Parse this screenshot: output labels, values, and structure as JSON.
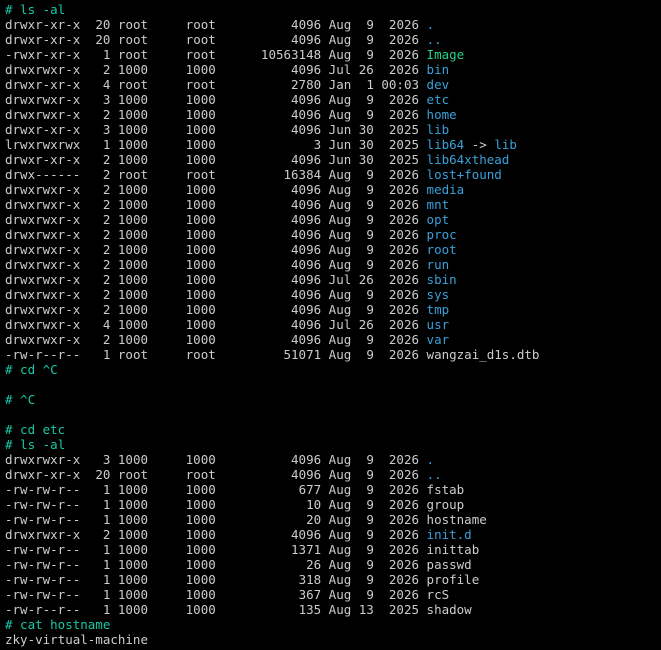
{
  "colors": {
    "background": "#000000",
    "text": "#cccccc",
    "prompt": "#17c9a6",
    "directory": "#3aa0d9",
    "executable": "#23d18b",
    "symlink": "#3aa0d9"
  },
  "lines": [
    {
      "kind": "prompt",
      "text": "# ls -al"
    },
    {
      "kind": "entry",
      "perms": "drwxr-xr-x",
      "links": "20",
      "owner": "root",
      "group": "root",
      "size": "4096",
      "month": "Aug",
      "day": "9",
      "yt": "2026",
      "name": ".",
      "type": "dir"
    },
    {
      "kind": "entry",
      "perms": "drwxr-xr-x",
      "links": "20",
      "owner": "root",
      "group": "root",
      "size": "4096",
      "month": "Aug",
      "day": "9",
      "yt": "2026",
      "name": "..",
      "type": "dir"
    },
    {
      "kind": "entry",
      "perms": "-rwxr-xr-x",
      "links": "1",
      "owner": "root",
      "group": "root",
      "size": "10563148",
      "month": "Aug",
      "day": "9",
      "yt": "2026",
      "name": "Image",
      "type": "exec"
    },
    {
      "kind": "entry",
      "perms": "drwxrwxr-x",
      "links": "2",
      "owner": "1000",
      "group": "1000",
      "size": "4096",
      "month": "Jul",
      "day": "26",
      "yt": "2026",
      "name": "bin",
      "type": "dir"
    },
    {
      "kind": "entry",
      "perms": "drwxr-xr-x",
      "links": "4",
      "owner": "root",
      "group": "root",
      "size": "2780",
      "month": "Jan",
      "day": "1",
      "yt": "00:03",
      "name": "dev",
      "type": "dir"
    },
    {
      "kind": "entry",
      "perms": "drwxrwxr-x",
      "links": "3",
      "owner": "1000",
      "group": "1000",
      "size": "4096",
      "month": "Aug",
      "day": "9",
      "yt": "2026",
      "name": "etc",
      "type": "dir"
    },
    {
      "kind": "entry",
      "perms": "drwxrwxr-x",
      "links": "2",
      "owner": "1000",
      "group": "1000",
      "size": "4096",
      "month": "Aug",
      "day": "9",
      "yt": "2026",
      "name": "home",
      "type": "dir"
    },
    {
      "kind": "entry",
      "perms": "drwxr-xr-x",
      "links": "3",
      "owner": "1000",
      "group": "1000",
      "size": "4096",
      "month": "Jun",
      "day": "30",
      "yt": "2025",
      "name": "lib",
      "type": "dir"
    },
    {
      "kind": "entry",
      "perms": "lrwxrwxrwx",
      "links": "1",
      "owner": "1000",
      "group": "1000",
      "size": "3",
      "month": "Jun",
      "day": "30",
      "yt": "2025",
      "name": "lib64",
      "type": "link",
      "target": "lib"
    },
    {
      "kind": "entry",
      "perms": "drwxr-xr-x",
      "links": "2",
      "owner": "1000",
      "group": "1000",
      "size": "4096",
      "month": "Jun",
      "day": "30",
      "yt": "2025",
      "name": "lib64xthead",
      "type": "dir"
    },
    {
      "kind": "entry",
      "perms": "drwx------",
      "links": "2",
      "owner": "root",
      "group": "root",
      "size": "16384",
      "month": "Aug",
      "day": "9",
      "yt": "2026",
      "name": "lost+found",
      "type": "dir"
    },
    {
      "kind": "entry",
      "perms": "drwxrwxr-x",
      "links": "2",
      "owner": "1000",
      "group": "1000",
      "size": "4096",
      "month": "Aug",
      "day": "9",
      "yt": "2026",
      "name": "media",
      "type": "dir"
    },
    {
      "kind": "entry",
      "perms": "drwxrwxr-x",
      "links": "2",
      "owner": "1000",
      "group": "1000",
      "size": "4096",
      "month": "Aug",
      "day": "9",
      "yt": "2026",
      "name": "mnt",
      "type": "dir"
    },
    {
      "kind": "entry",
      "perms": "drwxrwxr-x",
      "links": "2",
      "owner": "1000",
      "group": "1000",
      "size": "4096",
      "month": "Aug",
      "day": "9",
      "yt": "2026",
      "name": "opt",
      "type": "dir"
    },
    {
      "kind": "entry",
      "perms": "drwxrwxr-x",
      "links": "2",
      "owner": "1000",
      "group": "1000",
      "size": "4096",
      "month": "Aug",
      "day": "9",
      "yt": "2026",
      "name": "proc",
      "type": "dir"
    },
    {
      "kind": "entry",
      "perms": "drwxrwxr-x",
      "links": "2",
      "owner": "1000",
      "group": "1000",
      "size": "4096",
      "month": "Aug",
      "day": "9",
      "yt": "2026",
      "name": "root",
      "type": "dir"
    },
    {
      "kind": "entry",
      "perms": "drwxrwxr-x",
      "links": "2",
      "owner": "1000",
      "group": "1000",
      "size": "4096",
      "month": "Aug",
      "day": "9",
      "yt": "2026",
      "name": "run",
      "type": "dir"
    },
    {
      "kind": "entry",
      "perms": "drwxrwxr-x",
      "links": "2",
      "owner": "1000",
      "group": "1000",
      "size": "4096",
      "month": "Jul",
      "day": "26",
      "yt": "2026",
      "name": "sbin",
      "type": "dir"
    },
    {
      "kind": "entry",
      "perms": "drwxrwxr-x",
      "links": "2",
      "owner": "1000",
      "group": "1000",
      "size": "4096",
      "month": "Aug",
      "day": "9",
      "yt": "2026",
      "name": "sys",
      "type": "dir"
    },
    {
      "kind": "entry",
      "perms": "drwxrwxr-x",
      "links": "2",
      "owner": "1000",
      "group": "1000",
      "size": "4096",
      "month": "Aug",
      "day": "9",
      "yt": "2026",
      "name": "tmp",
      "type": "dir"
    },
    {
      "kind": "entry",
      "perms": "drwxrwxr-x",
      "links": "4",
      "owner": "1000",
      "group": "1000",
      "size": "4096",
      "month": "Jul",
      "day": "26",
      "yt": "2026",
      "name": "usr",
      "type": "dir"
    },
    {
      "kind": "entry",
      "perms": "drwxrwxr-x",
      "links": "2",
      "owner": "1000",
      "group": "1000",
      "size": "4096",
      "month": "Aug",
      "day": "9",
      "yt": "2026",
      "name": "var",
      "type": "dir"
    },
    {
      "kind": "entry",
      "perms": "-rw-r--r--",
      "links": "1",
      "owner": "root",
      "group": "root",
      "size": "51071",
      "month": "Aug",
      "day": "9",
      "yt": "2026",
      "name": "wangzai_d1s.dtb",
      "type": "file"
    },
    {
      "kind": "prompt",
      "text": "# cd ^C"
    },
    {
      "kind": "blank",
      "text": ""
    },
    {
      "kind": "prompt",
      "text": "# ^C"
    },
    {
      "kind": "blank",
      "text": ""
    },
    {
      "kind": "prompt",
      "text": "# cd etc"
    },
    {
      "kind": "prompt",
      "text": "# ls -al"
    },
    {
      "kind": "entry",
      "perms": "drwxrwxr-x",
      "links": "3",
      "owner": "1000",
      "group": "1000",
      "size": "4096",
      "month": "Aug",
      "day": "9",
      "yt": "2026",
      "name": ".",
      "type": "dir"
    },
    {
      "kind": "entry",
      "perms": "drwxr-xr-x",
      "links": "20",
      "owner": "root",
      "group": "root",
      "size": "4096",
      "month": "Aug",
      "day": "9",
      "yt": "2026",
      "name": "..",
      "type": "dir"
    },
    {
      "kind": "entry",
      "perms": "-rw-rw-r--",
      "links": "1",
      "owner": "1000",
      "group": "1000",
      "size": "677",
      "month": "Aug",
      "day": "9",
      "yt": "2026",
      "name": "fstab",
      "type": "file"
    },
    {
      "kind": "entry",
      "perms": "-rw-rw-r--",
      "links": "1",
      "owner": "1000",
      "group": "1000",
      "size": "10",
      "month": "Aug",
      "day": "9",
      "yt": "2026",
      "name": "group",
      "type": "file"
    },
    {
      "kind": "entry",
      "perms": "-rw-rw-r--",
      "links": "1",
      "owner": "1000",
      "group": "1000",
      "size": "20",
      "month": "Aug",
      "day": "9",
      "yt": "2026",
      "name": "hostname",
      "type": "file"
    },
    {
      "kind": "entry",
      "perms": "drwxrwxr-x",
      "links": "2",
      "owner": "1000",
      "group": "1000",
      "size": "4096",
      "month": "Aug",
      "day": "9",
      "yt": "2026",
      "name": "init.d",
      "type": "dir"
    },
    {
      "kind": "entry",
      "perms": "-rw-rw-r--",
      "links": "1",
      "owner": "1000",
      "group": "1000",
      "size": "1371",
      "month": "Aug",
      "day": "9",
      "yt": "2026",
      "name": "inittab",
      "type": "file"
    },
    {
      "kind": "entry",
      "perms": "-rw-rw-r--",
      "links": "1",
      "owner": "1000",
      "group": "1000",
      "size": "26",
      "month": "Aug",
      "day": "9",
      "yt": "2026",
      "name": "passwd",
      "type": "file"
    },
    {
      "kind": "entry",
      "perms": "-rw-rw-r--",
      "links": "1",
      "owner": "1000",
      "group": "1000",
      "size": "318",
      "month": "Aug",
      "day": "9",
      "yt": "2026",
      "name": "profile",
      "type": "file"
    },
    {
      "kind": "entry",
      "perms": "-rw-rw-r--",
      "links": "1",
      "owner": "1000",
      "group": "1000",
      "size": "367",
      "month": "Aug",
      "day": "9",
      "yt": "2026",
      "name": "rcS",
      "type": "file"
    },
    {
      "kind": "entry",
      "perms": "-rw-r--r--",
      "links": "1",
      "owner": "1000",
      "group": "1000",
      "size": "135",
      "month": "Aug",
      "day": "13",
      "yt": "2025",
      "name": "shadow",
      "type": "file"
    },
    {
      "kind": "prompt",
      "text": "# cat hostname"
    },
    {
      "kind": "output",
      "text": "zky-virtual-machine"
    }
  ]
}
